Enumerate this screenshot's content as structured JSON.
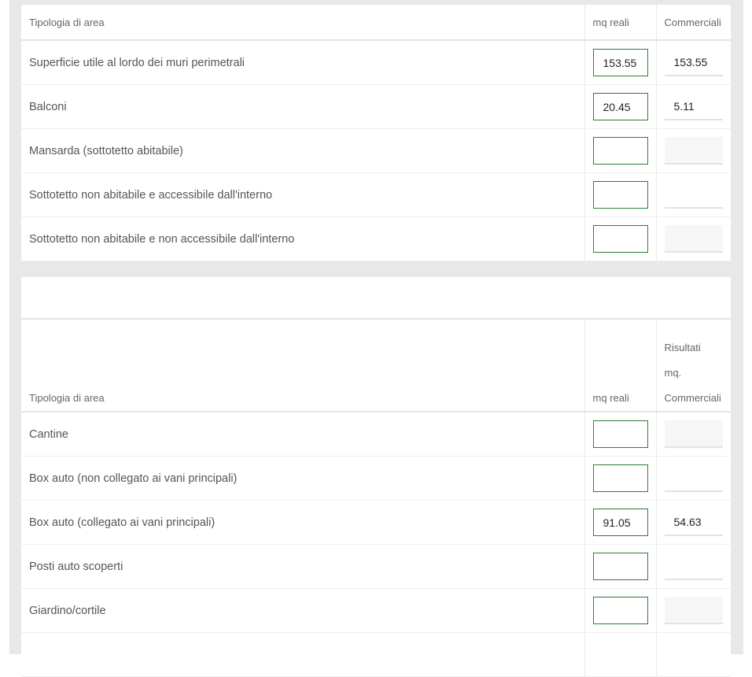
{
  "table1": {
    "header": {
      "tipologia": "Tipologia di area",
      "mq_reali": "mq reali",
      "commerciali": "Commerciali"
    },
    "rows": [
      {
        "label": "Superficie utile al lordo dei muri perimetrali",
        "mq": "153.55",
        "comm": "153.55"
      },
      {
        "label": "Balconi",
        "mq": "20.45",
        "comm": "5.11"
      },
      {
        "label": "Mansarda (sottotetto abitabile)",
        "mq": "",
        "comm": ""
      },
      {
        "label": "Sottotetto non abitabile e accessibile dall'interno",
        "mq": "",
        "comm": ""
      },
      {
        "label": "Sottotetto non abitabile e non accessibile dall'interno",
        "mq": "",
        "comm": ""
      }
    ]
  },
  "table2": {
    "header": {
      "tipologia": "Tipologia di area",
      "mq_reali": "mq reali",
      "risultati_line1": "Risultati",
      "risultati_line2": "mq.",
      "risultati_line3": "Commerciali"
    },
    "rows": [
      {
        "label": "Cantine",
        "mq": "",
        "comm": ""
      },
      {
        "label": "Box auto (non collegato ai vani principali)",
        "mq": "",
        "comm": ""
      },
      {
        "label": "Box auto (collegato ai vani principali)",
        "mq": "91.05",
        "comm": "54.63"
      },
      {
        "label": "Posti auto scoperti",
        "mq": "",
        "comm": ""
      },
      {
        "label": "Giardino/cortile",
        "mq": "",
        "comm": ""
      }
    ]
  },
  "colors": {
    "input_border": "#2e7d32",
    "frame_background": "#e8e8e8"
  }
}
